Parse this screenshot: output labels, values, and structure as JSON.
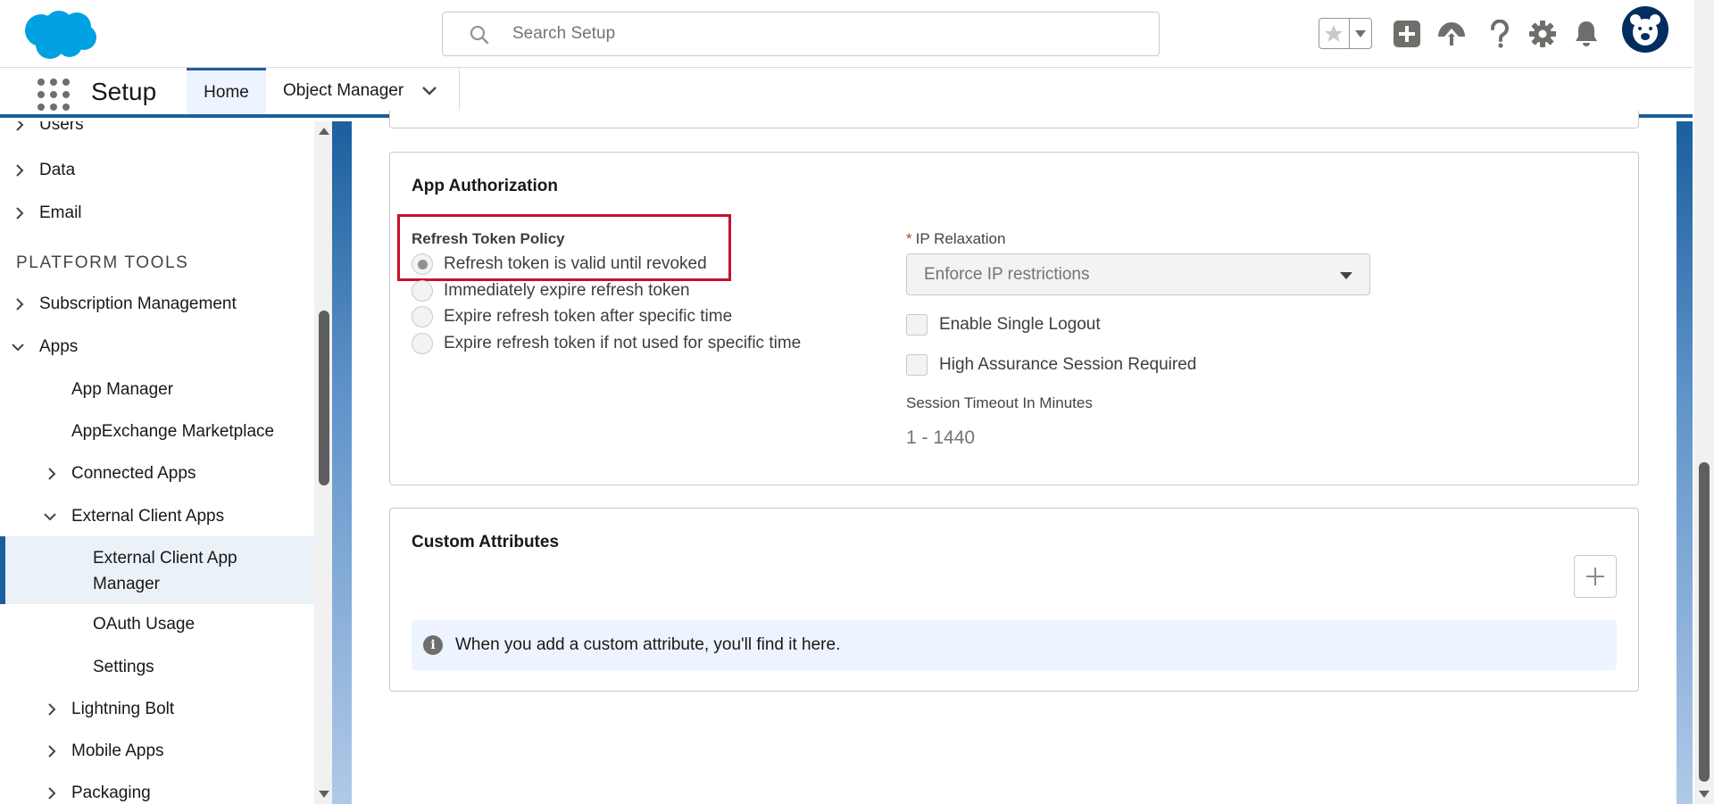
{
  "header": {
    "search_placeholder": "Search Setup",
    "icons": [
      "salesforce-logo",
      "search-icon",
      "favorites-star-icon",
      "favorites-dropdown-icon",
      "add-icon",
      "trailhead-icon",
      "help-icon",
      "setup-gear-icon",
      "notifications-bell-icon",
      "avatar"
    ]
  },
  "nav": {
    "app_name": "Setup",
    "tabs": [
      {
        "label": "Home",
        "active": true
      },
      {
        "label": "Object Manager",
        "active": false
      }
    ]
  },
  "sidebar": {
    "items_top": [
      "Users",
      "Data",
      "Email"
    ],
    "section_heading": "PLATFORM TOOLS",
    "subscription": "Subscription Management",
    "apps": "Apps",
    "app_manager": "App Manager",
    "appexchange": "AppExchange Marketplace",
    "connected_apps": "Connected Apps",
    "external_client_apps": "External Client Apps",
    "ext_mgr_line1": "External Client App",
    "ext_mgr_line2": "Manager",
    "oauth_usage": "OAuth Usage",
    "settings": "Settings",
    "lightning_bolt": "Lightning Bolt",
    "mobile_apps": "Mobile Apps",
    "packaging": "Packaging"
  },
  "app_authorization": {
    "title": "App Authorization",
    "refresh_label": "Refresh Token Policy",
    "refresh_options": [
      {
        "label": "Refresh token is valid until revoked",
        "checked": true
      },
      {
        "label": "Immediately expire refresh token",
        "checked": false
      },
      {
        "label": "Expire refresh token after specific time",
        "checked": false
      },
      {
        "label": "Expire refresh token if not used for specific time",
        "checked": false
      }
    ],
    "ip_required_mark": "*",
    "ip_label": "IP Relaxation",
    "ip_value": "Enforce IP restrictions",
    "single_logout": "Enable Single Logout",
    "high_assurance": "High Assurance Session Required",
    "session_timeout_label": "Session Timeout In Minutes",
    "session_timeout_placeholder": "1 - 1440"
  },
  "custom_attributes": {
    "title": "Custom Attributes",
    "add_button": "+",
    "info_icon": "i",
    "empty_message": "When you add a custom attribute, you'll find it here."
  },
  "colors": {
    "brand_blue": "#1b5f9e",
    "logo_blue": "#00a1e0",
    "highlight_red": "#c8102e"
  }
}
